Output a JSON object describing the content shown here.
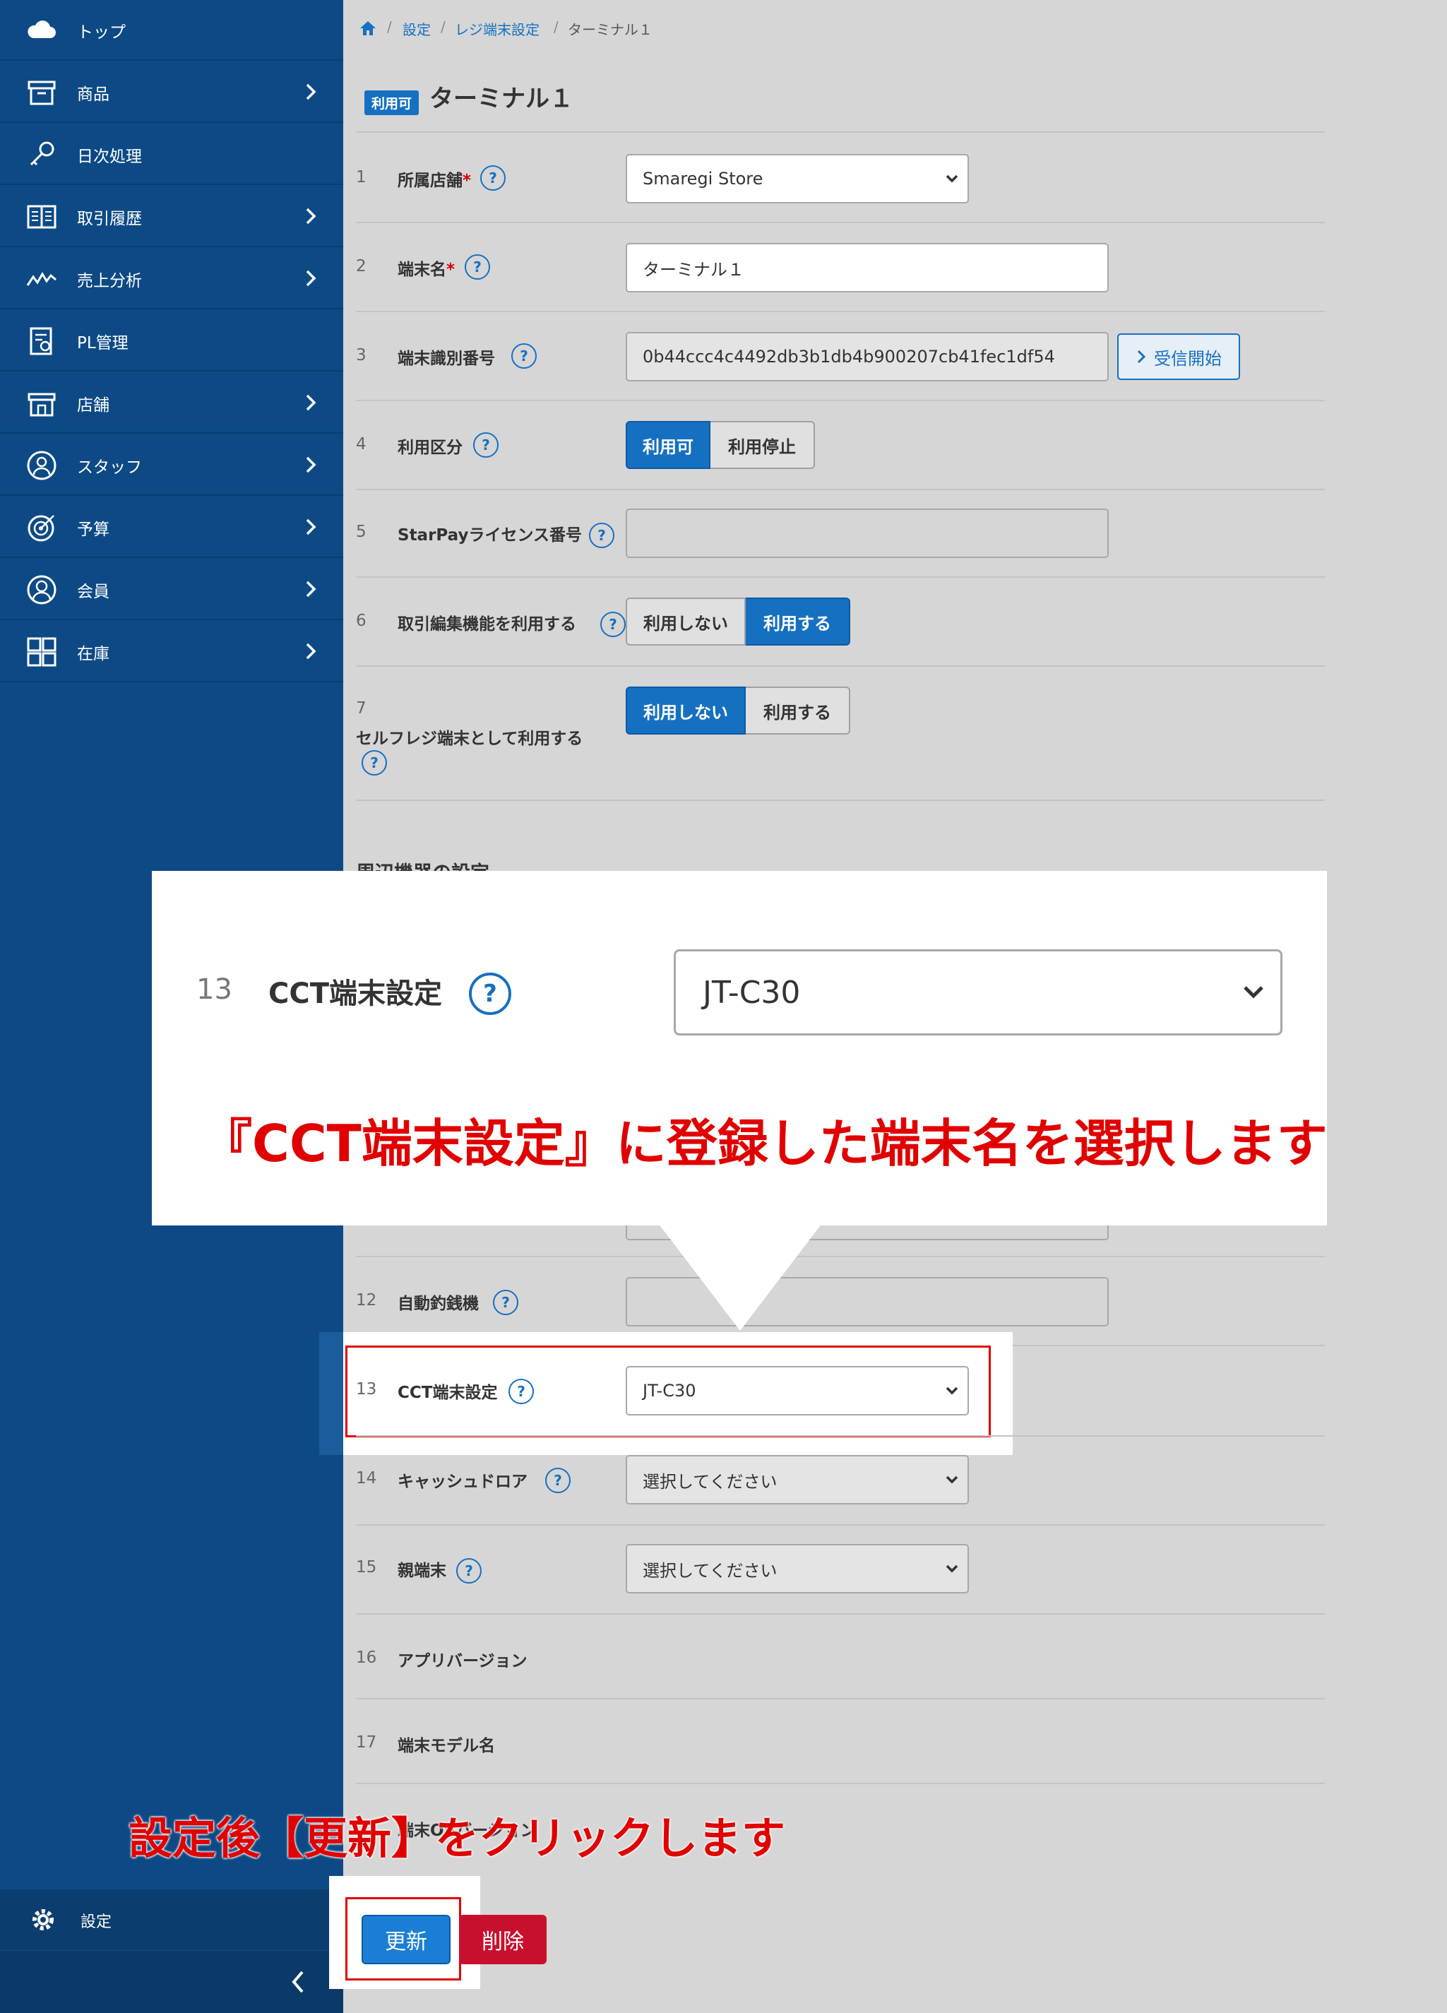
{
  "sidebar": {
    "items": [
      {
        "label": "トップ",
        "icon": "cloud-icon",
        "chevron": false
      },
      {
        "label": "商品",
        "icon": "box-icon",
        "chevron": true
      },
      {
        "label": "日次処理",
        "icon": "key-icon",
        "chevron": false
      },
      {
        "label": "取引履歴",
        "icon": "book-icon",
        "chevron": true
      },
      {
        "label": "売上分析",
        "icon": "line-chart-icon",
        "chevron": true
      },
      {
        "label": "PL管理",
        "icon": "report-icon",
        "chevron": false
      },
      {
        "label": "店舗",
        "icon": "store-icon",
        "chevron": true
      },
      {
        "label": "スタッフ",
        "icon": "staff-icon",
        "chevron": true
      },
      {
        "label": "予算",
        "icon": "target-icon",
        "chevron": true
      },
      {
        "label": "会員",
        "icon": "member-icon",
        "chevron": true
      },
      {
        "label": "在庫",
        "icon": "grid-icon",
        "chevron": true
      }
    ],
    "settings_label": "設定"
  },
  "breadcrumb": {
    "items": [
      "設定",
      "レジ端末設定",
      "ターミナル１"
    ],
    "separator": "/"
  },
  "header": {
    "status_badge": "利用可",
    "title": "ターミナル１"
  },
  "form": {
    "rows": [
      {
        "num": "1",
        "label": "所属店舗",
        "required": true,
        "value": "Smaregi Store"
      },
      {
        "num": "2",
        "label": "端末名",
        "required": true,
        "value": "ターミナル１"
      },
      {
        "num": "3",
        "label": "端末識別番号",
        "value": "0b44ccc4c4492db3b1db4b900207cb41fec1df54",
        "button": "受信開始"
      },
      {
        "num": "4",
        "label": "利用区分",
        "options": [
          "利用可",
          "利用停止"
        ],
        "selected": "利用可"
      },
      {
        "num": "5",
        "label": "StarPayライセンス番号",
        "value": ""
      },
      {
        "num": "6",
        "label": "取引編集機能を利用する",
        "options": [
          "利用しない",
          "利用する"
        ],
        "selected": "利用する"
      },
      {
        "num": "7",
        "label": "セルフレジ端末として利用する",
        "options": [
          "利用しない",
          "利用する"
        ],
        "selected": "利用しない"
      },
      {
        "num": "12",
        "label": "自動釣銭機",
        "value": ""
      },
      {
        "num": "13",
        "label": "CCT端末設定",
        "value": "JT-C30"
      },
      {
        "num": "14",
        "label": "キャッシュドロア",
        "value": "選択してください"
      },
      {
        "num": "15",
        "label": "親端末",
        "value": "選択してください"
      },
      {
        "num": "16",
        "label": "アプリバージョン"
      },
      {
        "num": "17",
        "label": "端末モデル名"
      }
    ],
    "section_heading": "周辺機器の設定",
    "help_glyph": "?"
  },
  "callout": {
    "num": "13",
    "label": "CCT端末設定",
    "value": "JT-C30",
    "text": "『CCT端末設定』に登録した端末名を選択します"
  },
  "bottom": {
    "hint": "設定後【更新】をクリックします",
    "partial_row_label": "端末OSバージョン",
    "update_label": "更新",
    "delete_label": "削除"
  },
  "colors": {
    "sidebar_bg": "#0d4a85",
    "accent": "#1670c2",
    "annotation_red": "#e10000",
    "delete_red": "#c8102e"
  }
}
